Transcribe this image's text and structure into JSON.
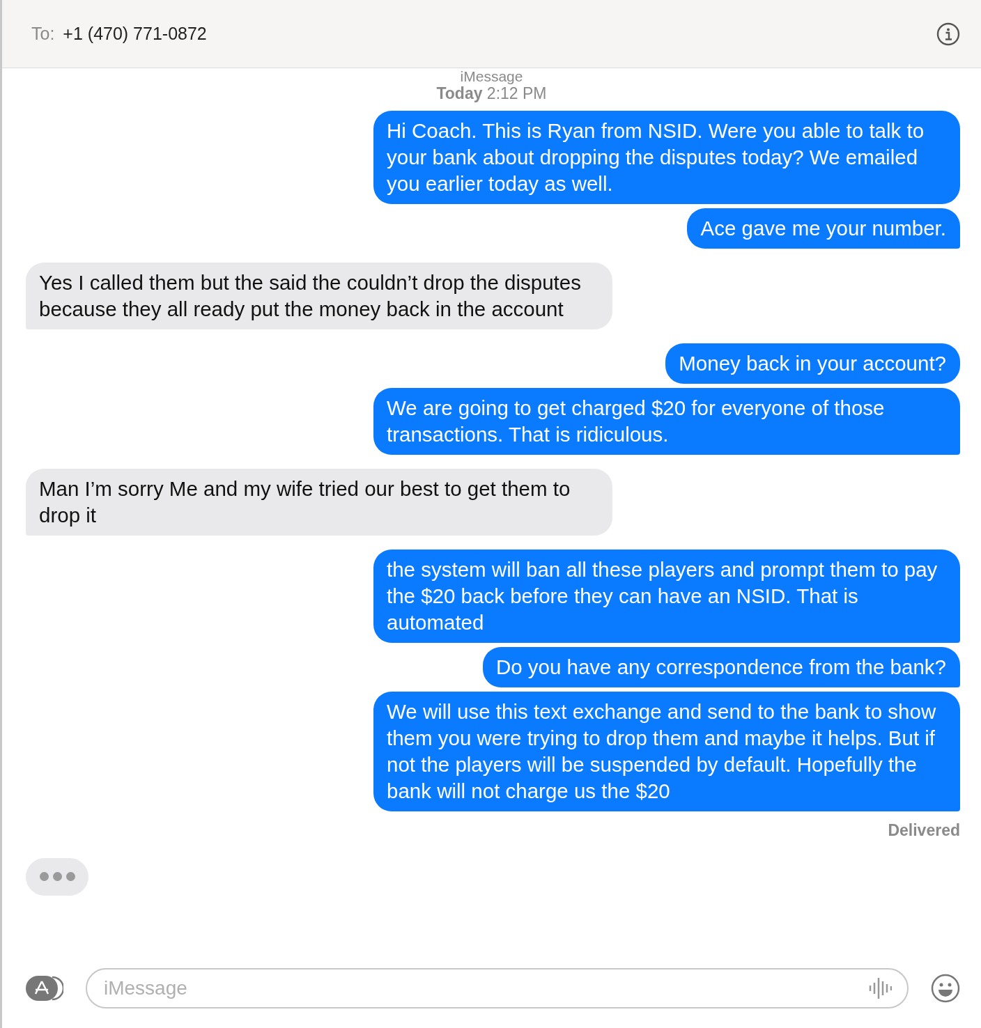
{
  "header": {
    "to_label": "To:",
    "recipient": "+1 (470) 771-0872"
  },
  "service_label": "iMessage",
  "timestamp": {
    "day": "Today",
    "time": "2:12 PM"
  },
  "messages": [
    {
      "kind": "sent",
      "text": "Hi Coach. This is Ryan from NSID. Were you able to talk to your bank about dropping the disputes today? We emailed you earlier today as well.",
      "tail": false
    },
    {
      "kind": "sent",
      "text": "Ace gave me your number.",
      "tail": true
    },
    {
      "kind": "received",
      "text": "Yes I called them but the said the couldn’t drop the disputes because they all ready put the money back in the account",
      "tail": true
    },
    {
      "kind": "sent",
      "text": "Money back in your account?",
      "tail": false
    },
    {
      "kind": "sent",
      "text": "We are going to get charged $20 for everyone of those transactions. That is ridiculous.",
      "tail": true
    },
    {
      "kind": "received",
      "text": "Man I’m sorry Me and my wife tried our best to get them to drop it",
      "tail": true
    },
    {
      "kind": "sent",
      "text": "the system will ban all these players and prompt them to pay the $20 back before they can have an NSID. That is automated",
      "tail": true
    },
    {
      "kind": "sent",
      "text": "Do you have any correspondence from the bank?",
      "tail": true
    },
    {
      "kind": "sent",
      "text": "We will use this text exchange and send to the bank to show them you were trying to drop them and maybe it helps. But if not the players will be suspended by default. Hopefully the bank will not charge us the $20",
      "tail": true
    }
  ],
  "delivery_status": "Delivered",
  "typing_indicator": true,
  "composer": {
    "placeholder": "iMessage"
  }
}
